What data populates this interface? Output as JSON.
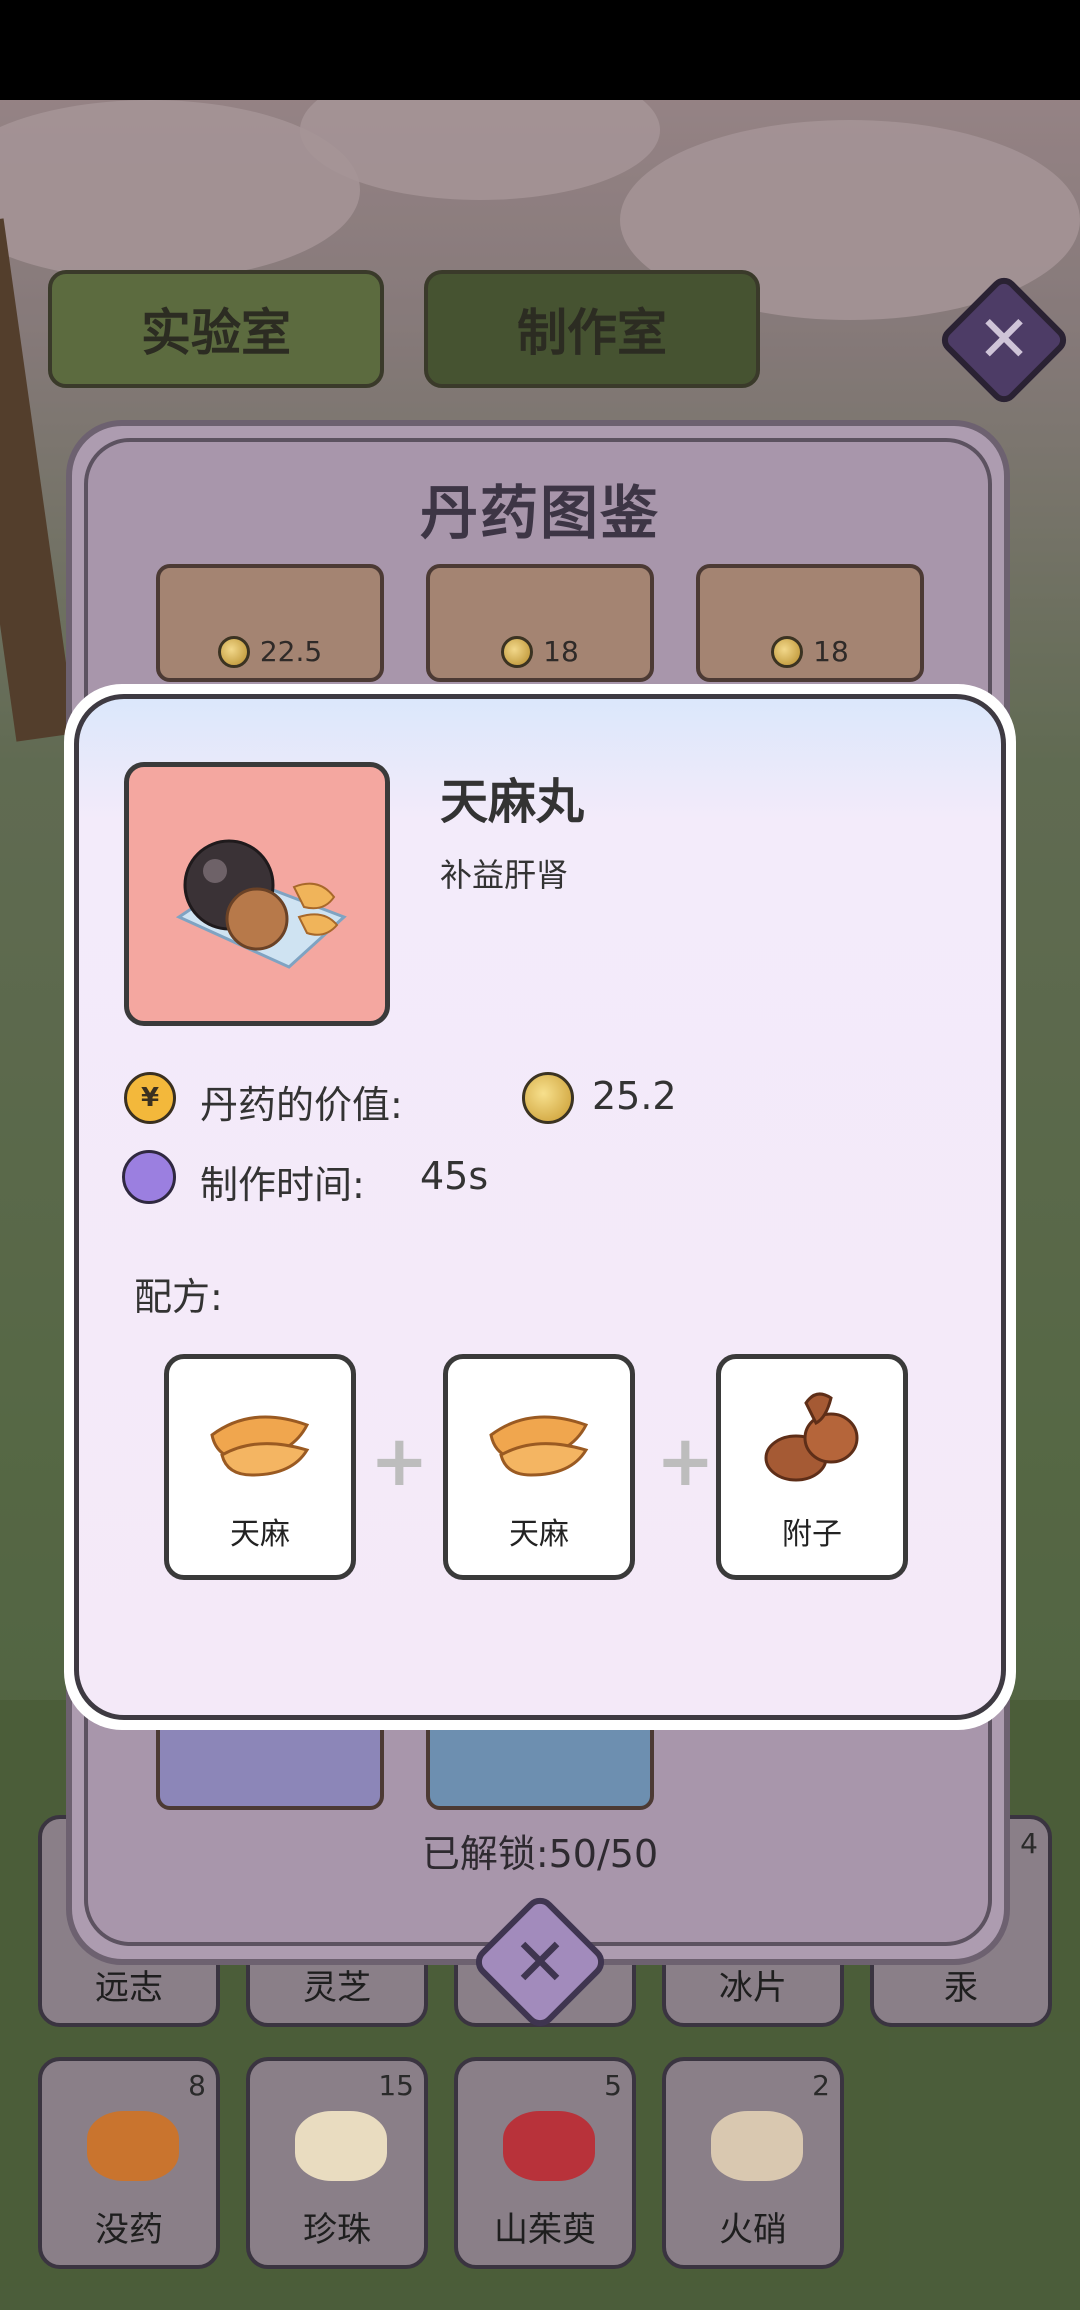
{
  "tabs": [
    {
      "label": "实验室",
      "active": false
    },
    {
      "label": "制作室",
      "active": true
    }
  ],
  "book": {
    "title": "丹药图鉴",
    "top_cards": [
      {
        "price": "22.5"
      },
      {
        "price": "18"
      },
      {
        "price": "18"
      }
    ],
    "unlock_text": "已解锁:50/50"
  },
  "detail": {
    "name": "天麻丸",
    "description": "补益肝肾",
    "value_label": "丹药的价值:",
    "value": "25.2",
    "time_label": "制作时间:",
    "time_value": "45s",
    "recipe_label": "配方:",
    "ingredients": [
      {
        "name": "天麻",
        "icon": "tianma-root-icon"
      },
      {
        "name": "天麻",
        "icon": "tianma-root-icon"
      },
      {
        "name": "附子",
        "icon": "fuzi-root-icon"
      }
    ]
  },
  "inventory": {
    "row1": [
      {
        "name": "远志",
        "count": ""
      },
      {
        "name": "灵芝",
        "count": ""
      },
      {
        "name": "",
        "count": ""
      },
      {
        "name": "冰片",
        "count": ""
      },
      {
        "name": "汞",
        "count": "4"
      }
    ],
    "row2": [
      {
        "name": "没药",
        "count": "8",
        "color": "#c9742e"
      },
      {
        "name": "珍珠",
        "count": "15",
        "color": "#e9dcc0"
      },
      {
        "name": "山茱萸",
        "count": "5",
        "color": "#b8323a"
      },
      {
        "name": "火硝",
        "count": "2",
        "color": "#d9c8b0"
      }
    ]
  },
  "colors": {
    "item_bg": "#f4a7a0",
    "dialog_bg": "#f4e9f8",
    "accent_purple": "#9b7fe0"
  }
}
